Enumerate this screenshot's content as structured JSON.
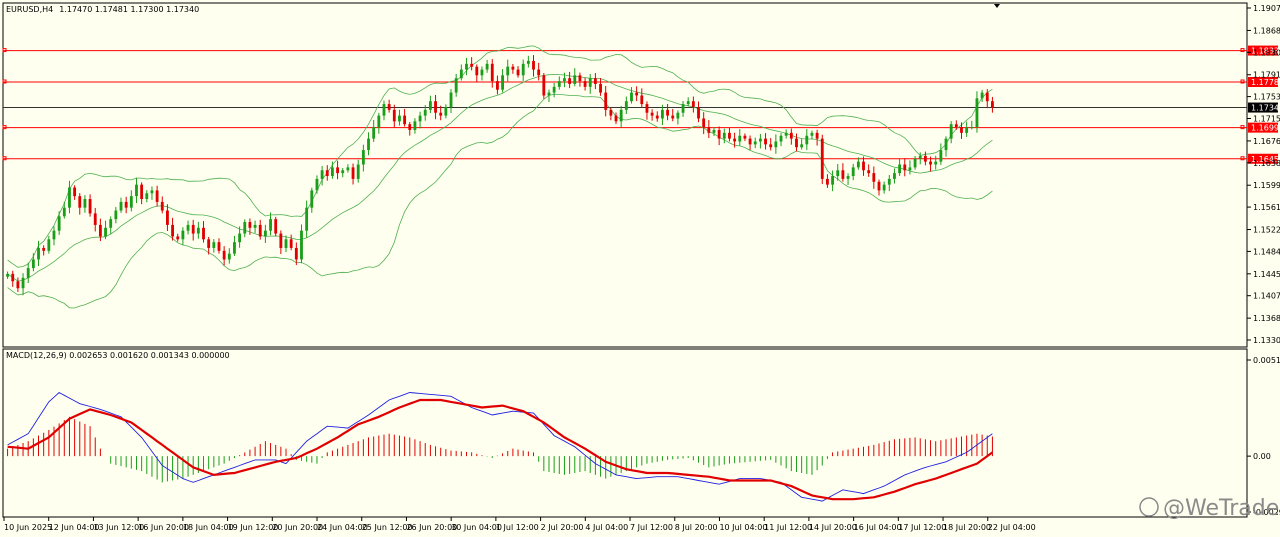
{
  "header": {
    "symbol": "EURUSD,H4",
    "ohlc": "1.17470 1.17481 1.17300 1.17340"
  },
  "macd_header": "MACD(12,26,9) 0.002653 0.001620 0.001343 0.000000",
  "watermark": "@WeTrade",
  "colors": {
    "background": "#fffff0",
    "bull": "#1a9e1a",
    "bear": "#e00000",
    "bands": "#4fb04f",
    "level": "#ff0000",
    "macd": "#2020e0",
    "signal": "#e00000"
  },
  "chart_data": [
    {
      "type": "candlestick",
      "title": "EURUSD,H4",
      "x_labels": [
        "10 Jun 2025",
        "12 Jun 04:00",
        "13 Jun 12:00",
        "16 Jun 20:00",
        "18 Jun 04:00",
        "19 Jun 12:00",
        "20 Jun 20:00",
        "24 Jun 04:00",
        "25 Jun 12:00",
        "26 Jun 20:00",
        "30 Jun 04:00",
        "1 Jul 12:00",
        "2 Jul 20:00",
        "4 Jul 04:00",
        "7 Jul 12:00",
        "8 Jul 20:00",
        "10 Jul 04:00",
        "11 Jul 12:00",
        "14 Jul 20:00",
        "16 Jul 04:00",
        "17 Jul 12:00",
        "18 Jul 20:00",
        "22 Jul 04:00"
      ],
      "y_ticks": [
        "1.19070",
        "1.18680",
        "1.18300",
        "1.17910",
        "1.17530",
        "1.17150",
        "1.16760",
        "1.16380",
        "1.15990",
        "1.15610",
        "1.15220",
        "1.14840",
        "1.14450",
        "1.14070",
        "1.13680",
        "1.13300"
      ],
      "ylim": [
        1.133,
        1.1907
      ],
      "price_levels": [
        "1.18330",
        "1.17784",
        "1.16991",
        "1.16450"
      ],
      "current_price": "1.17340",
      "indicator": "Bollinger Bands",
      "closes": [
        1.1445,
        1.1432,
        1.142,
        1.1438,
        1.1455,
        1.147,
        1.149,
        1.1485,
        1.1505,
        1.152,
        1.1545,
        1.156,
        1.1595,
        1.158,
        1.156,
        1.1575,
        1.155,
        1.153,
        1.151,
        1.1525,
        1.154,
        1.1555,
        1.157,
        1.156,
        1.158,
        1.16,
        1.1575,
        1.1585,
        1.159,
        1.157,
        1.1555,
        1.153,
        1.151,
        1.1505,
        1.152,
        1.153,
        1.1515,
        1.1525,
        1.1505,
        1.149,
        1.15,
        1.1485,
        1.147,
        1.148,
        1.15,
        1.1515,
        1.1535,
        1.1525,
        1.153,
        1.151,
        1.152,
        1.154,
        1.1515,
        1.149,
        1.1505,
        1.149,
        1.147,
        1.152,
        1.156,
        1.159,
        1.161,
        1.1625,
        1.1615,
        1.163,
        1.162,
        1.1625,
        1.163,
        1.161,
        1.1635,
        1.166,
        1.168,
        1.17,
        1.172,
        1.174,
        1.173,
        1.171,
        1.172,
        1.1705,
        1.1695,
        1.171,
        1.172,
        1.173,
        1.1745,
        1.1725,
        1.172,
        1.1735,
        1.176,
        1.1785,
        1.18,
        1.181,
        1.1805,
        1.179,
        1.18,
        1.181,
        1.178,
        1.1765,
        1.179,
        1.1805,
        1.18,
        1.179,
        1.181,
        1.1815,
        1.18,
        1.179,
        1.1755,
        1.176,
        1.177,
        1.178,
        1.1785,
        1.1775,
        1.179,
        1.178,
        1.177,
        1.1785,
        1.1775,
        1.176,
        1.173,
        1.172,
        1.171,
        1.173,
        1.1745,
        1.176,
        1.1755,
        1.174,
        1.1725,
        1.172,
        1.1715,
        1.173,
        1.172,
        1.1715,
        1.1725,
        1.174,
        1.1745,
        1.1735,
        1.1715,
        1.17,
        1.169,
        1.1695,
        1.168,
        1.169,
        1.168,
        1.1675,
        1.1685,
        1.168,
        1.167,
        1.1675,
        1.168,
        1.167,
        1.1665,
        1.1675,
        1.1685,
        1.169,
        1.168,
        1.1665,
        1.167,
        1.1685,
        1.169,
        1.168,
        1.161,
        1.16,
        1.1615,
        1.1625,
        1.161,
        1.1615,
        1.163,
        1.164,
        1.1625,
        1.162,
        1.1605,
        1.159,
        1.16,
        1.161,
        1.162,
        1.1635,
        1.1625,
        1.163,
        1.1645,
        1.165,
        1.164,
        1.1635,
        1.164,
        1.166,
        1.168,
        1.1705,
        1.17,
        1.169,
        1.17,
        1.17,
        1.175,
        1.176,
        1.1745,
        1.1734
      ]
    },
    {
      "type": "line",
      "title": "MACD(12,26,9) 0.002653 0.001620 0.001343 0.000000",
      "y_ticks": [
        "0.005137",
        "0.00",
        "-0.002985"
      ],
      "ylim": [
        -0.002985,
        0.005137
      ],
      "series": [
        {
          "name": "MACD",
          "anchors": [
            [
              0,
              0.0006
            ],
            [
              4,
              0.0012
            ],
            [
              8,
              0.0029
            ],
            [
              10,
              0.0034
            ],
            [
              14,
              0.0028
            ],
            [
              18,
              0.0025
            ],
            [
              22,
              0.0021
            ],
            [
              26,
              0.001
            ],
            [
              30,
              -0.0005
            ],
            [
              34,
              -0.0012
            ],
            [
              36,
              -0.0014
            ],
            [
              40,
              -0.001
            ],
            [
              44,
              -0.0006
            ],
            [
              48,
              -0.0002
            ],
            [
              52,
              -0.0002
            ],
            [
              54,
              -0.0004
            ],
            [
              58,
              0.0008
            ],
            [
              62,
              0.0016
            ],
            [
              66,
              0.0015
            ],
            [
              70,
              0.0022
            ],
            [
              74,
              0.003
            ],
            [
              78,
              0.0034
            ],
            [
              82,
              0.0033
            ],
            [
              86,
              0.0032
            ],
            [
              90,
              0.0026
            ],
            [
              94,
              0.0022
            ],
            [
              98,
              0.0024
            ],
            [
              102,
              0.0023
            ],
            [
              106,
              0.0011
            ],
            [
              110,
              0.0005
            ],
            [
              114,
              -0.0004
            ],
            [
              118,
              -0.001
            ],
            [
              122,
              -0.0012
            ],
            [
              126,
              -0.0011
            ],
            [
              130,
              -0.0011
            ],
            [
              134,
              -0.0013
            ],
            [
              138,
              -0.0015
            ],
            [
              142,
              -0.0012
            ],
            [
              146,
              -0.0012
            ],
            [
              150,
              -0.0014
            ],
            [
              154,
              -0.0022
            ],
            [
              158,
              -0.0024
            ],
            [
              162,
              -0.0018
            ],
            [
              166,
              -0.002
            ],
            [
              170,
              -0.0016
            ],
            [
              174,
              -0.001
            ],
            [
              178,
              -0.0006
            ],
            [
              182,
              -0.0003
            ],
            [
              186,
              0.0002
            ],
            [
              190,
              0.001
            ],
            [
              194,
              0.0018
            ],
            [
              196,
              0.002
            ]
          ]
        },
        {
          "name": "Signal",
          "anchors": [
            [
              0,
              0.0005
            ],
            [
              4,
              0.0004
            ],
            [
              8,
              0.001
            ],
            [
              12,
              0.002
            ],
            [
              16,
              0.0025
            ],
            [
              20,
              0.0022
            ],
            [
              24,
              0.0018
            ],
            [
              28,
              0.001
            ],
            [
              32,
              0.0002
            ],
            [
              36,
              -0.0006
            ],
            [
              40,
              -0.001
            ],
            [
              44,
              -0.0009
            ],
            [
              48,
              -0.0006
            ],
            [
              52,
              -0.0003
            ],
            [
              56,
              -0.0001
            ],
            [
              60,
              0.0004
            ],
            [
              64,
              0.001
            ],
            [
              68,
              0.0017
            ],
            [
              72,
              0.0021
            ],
            [
              76,
              0.0026
            ],
            [
              80,
              0.003
            ],
            [
              84,
              0.003
            ],
            [
              88,
              0.0028
            ],
            [
              92,
              0.0026
            ],
            [
              96,
              0.0027
            ],
            [
              100,
              0.0024
            ],
            [
              104,
              0.0018
            ],
            [
              108,
              0.001
            ],
            [
              112,
              0.0004
            ],
            [
              116,
              -0.0003
            ],
            [
              120,
              -0.0007
            ],
            [
              124,
              -0.0009
            ],
            [
              128,
              -0.0009
            ],
            [
              132,
              -0.001
            ],
            [
              136,
              -0.0011
            ],
            [
              140,
              -0.0013
            ],
            [
              144,
              -0.0013
            ],
            [
              148,
              -0.0013
            ],
            [
              152,
              -0.0016
            ],
            [
              156,
              -0.0021
            ],
            [
              160,
              -0.0023
            ],
            [
              164,
              -0.0023
            ],
            [
              168,
              -0.0022
            ],
            [
              172,
              -0.0019
            ],
            [
              176,
              -0.0015
            ],
            [
              180,
              -0.0012
            ],
            [
              184,
              -0.0008
            ],
            [
              188,
              -0.0004
            ],
            [
              192,
              0.0004
            ],
            [
              196,
              0.0011
            ]
          ]
        },
        {
          "name": "Histogram",
          "anchors": [
            [
              0,
              0.0004
            ],
            [
              4,
              0.0008
            ],
            [
              8,
              0.0014
            ],
            [
              12,
              0.0021
            ],
            [
              16,
              0.0016
            ],
            [
              18,
              0.0004
            ],
            [
              20,
              -0.0004
            ],
            [
              26,
              -0.0008
            ],
            [
              30,
              -0.0014
            ],
            [
              34,
              -0.0012
            ],
            [
              38,
              -0.0008
            ],
            [
              42,
              -0.0004
            ],
            [
              46,
              0.0002
            ],
            [
              50,
              0.0008
            ],
            [
              54,
              0.0004
            ],
            [
              56,
              -0.0002
            ],
            [
              60,
              -0.0004
            ],
            [
              62,
              0.0002
            ],
            [
              66,
              0.0006
            ],
            [
              70,
              0.001
            ],
            [
              74,
              0.0012
            ],
            [
              78,
              0.001
            ],
            [
              82,
              0.0006
            ],
            [
              86,
              0.0003
            ],
            [
              90,
              0.0002
            ],
            [
              94,
              -0.0001
            ],
            [
              98,
              0.0004
            ],
            [
              102,
              0.0002
            ],
            [
              104,
              -0.0008
            ],
            [
              108,
              -0.001
            ],
            [
              112,
              -0.0008
            ],
            [
              116,
              -0.0012
            ],
            [
              120,
              -0.0008
            ],
            [
              124,
              -0.0004
            ],
            [
              128,
              -0.0002
            ],
            [
              132,
              -0.0001
            ],
            [
              136,
              -0.0006
            ],
            [
              140,
              -0.0004
            ],
            [
              144,
              -0.0003
            ],
            [
              148,
              -0.0002
            ],
            [
              152,
              -0.0008
            ],
            [
              156,
              -0.001
            ],
            [
              158,
              -0.0005
            ],
            [
              160,
              0.0002
            ],
            [
              164,
              0.0004
            ],
            [
              168,
              0.0006
            ],
            [
              172,
              0.0009
            ],
            [
              176,
              0.001
            ],
            [
              180,
              0.0008
            ],
            [
              184,
              0.001
            ],
            [
              188,
              0.0012
            ],
            [
              192,
              0.001
            ],
            [
              196,
              0.0012
            ]
          ]
        }
      ]
    }
  ]
}
